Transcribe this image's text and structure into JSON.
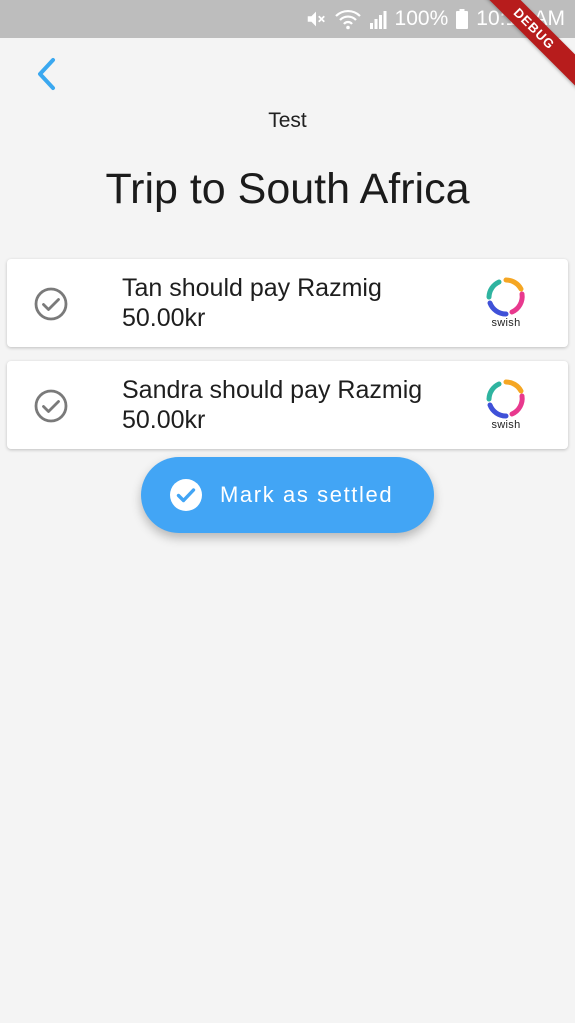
{
  "status_bar": {
    "battery": "100%",
    "time": "10:15 AM",
    "icons": [
      "mute-icon",
      "wifi-icon",
      "signal-icon",
      "battery-icon"
    ]
  },
  "debug_banner": "DEBUG",
  "header": {
    "back_icon": "chevron-left-icon",
    "group_name": "Test",
    "title": "Trip to South Africa"
  },
  "debts": [
    {
      "description": "Tan should pay Razmig",
      "amount": "50.00kr",
      "icon": "check-circle-outline-icon",
      "pay_label": "swish"
    },
    {
      "description": "Sandra should pay Razmig",
      "amount": "50.00kr",
      "icon": "check-circle-outline-icon",
      "pay_label": "swish"
    }
  ],
  "settle_button": {
    "label": "Mark as settled",
    "icon": "check-circle-icon"
  },
  "colors": {
    "accent": "#42a5f5",
    "back_arrow": "#3aa8f0",
    "background": "#f4f4f4",
    "status_bar": "#bdbdbd",
    "debug_ribbon": "#b71c1c"
  }
}
